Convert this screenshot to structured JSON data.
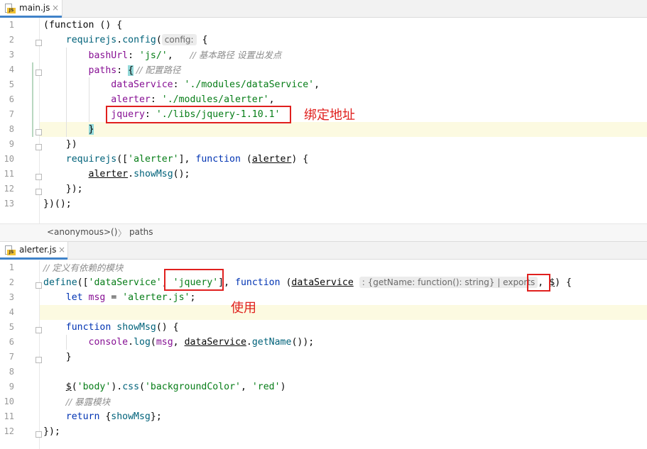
{
  "editor_top": {
    "tab": {
      "name": "main.js",
      "close": "×",
      "icon": "js-file-icon",
      "icon_label": "JS"
    },
    "lines": [
      {
        "n": "1"
      },
      {
        "n": "2"
      },
      {
        "n": "3"
      },
      {
        "n": "4"
      },
      {
        "n": "5"
      },
      {
        "n": "6"
      },
      {
        "n": "7"
      },
      {
        "n": "8"
      },
      {
        "n": "9"
      },
      {
        "n": "10"
      },
      {
        "n": "11"
      },
      {
        "n": "12"
      },
      {
        "n": "13"
      }
    ],
    "tokens": {
      "l1_a": "(function () {",
      "l2_a": "requirejs",
      "l2_b": ".",
      "l2_c": "config",
      "l2_d": "(",
      "l2_hint": "config:",
      "l2_e": " {",
      "l3_a": "bashUrl",
      "l3_b": ": ",
      "l3_c": "'js/'",
      "l3_d": ",   ",
      "l3_cm": "// 基本路径 设置出发点",
      "l4_a": "paths",
      "l4_b": ": ",
      "l4_c": "{",
      "l4_cm": " // 配置路径",
      "l5_a": "dataService",
      "l5_b": ": ",
      "l5_c": "'./modules/dataService'",
      "l5_d": ",",
      "l6_a": "alerter",
      "l6_b": ": ",
      "l6_c": "'./modules/alerter'",
      "l6_d": ",",
      "l7_a": "jquery",
      "l7_b": ": ",
      "l7_c": "'./libs/jquery-1.10.1'",
      "l8_a": "}",
      "l9_a": "})",
      "l10_a": "requirejs",
      "l10_b": "([",
      "l10_c": "'alerter'",
      "l10_d": "], ",
      "l10_e": "function",
      "l10_f": " (",
      "l10_g": "alerter",
      "l10_h": ") {",
      "l11_a": "alerter",
      "l11_b": ".",
      "l11_c": "showMsg",
      "l11_d": "();",
      "l12_a": "});",
      "l13_a": "})();"
    },
    "annotation": "绑定地址"
  },
  "breadcrumb": {
    "item1": "<anonymous>()",
    "sep": "〉",
    "item2": "paths"
  },
  "editor_bottom": {
    "tab": {
      "name": "alerter.js",
      "close": "×",
      "icon": "js-file-icon",
      "icon_label": "JS"
    },
    "lines": [
      {
        "n": "1"
      },
      {
        "n": "2"
      },
      {
        "n": "3"
      },
      {
        "n": "4"
      },
      {
        "n": "5"
      },
      {
        "n": "6"
      },
      {
        "n": "7"
      },
      {
        "n": "8"
      },
      {
        "n": "9"
      },
      {
        "n": "10"
      },
      {
        "n": "11"
      },
      {
        "n": "12"
      }
    ],
    "tokens": {
      "l1_cm": "// 定义有依赖的模块",
      "l2_a": "define",
      "l2_b": "([",
      "l2_c": "'dataService'",
      "l2_d": ", ",
      "l2_e": "'jquery'",
      "l2_f": "], ",
      "l2_g": "function",
      "l2_h": " (",
      "l2_i": "dataService",
      "l2_hint": ": {getName: function(): string} | exports",
      "l2_j": ", ",
      "l2_k": "$",
      "l2_l": ") {",
      "l3_a": "let",
      "l3_b": " ",
      "l3_c": "msg",
      "l3_d": " = ",
      "l3_e": "'alerter.js'",
      "l3_f": ";",
      "l5_a": "function",
      "l5_b": " ",
      "l5_c": "showMsg",
      "l5_d": "() {",
      "l6_a": "console",
      "l6_b": ".",
      "l6_c": "log",
      "l6_d": "(",
      "l6_e": "msg",
      "l6_f": ", ",
      "l6_g": "dataService",
      "l6_h": ".",
      "l6_i": "getName",
      "l6_j": "());",
      "l7_a": "}",
      "l9_a": "$",
      "l9_b": "(",
      "l9_c": "'body'",
      "l9_d": ").",
      "l9_e": "css",
      "l9_f": "(",
      "l9_g": "'backgroundColor'",
      "l9_h": ", ",
      "l9_i": "'red'",
      "l9_j": ")",
      "l10_cm": "// 暴露模块",
      "l11_a": "return",
      "l11_b": " {",
      "l11_c": "showMsg",
      "l11_d": "};",
      "l12_a": "});"
    },
    "annotation": "使用"
  },
  "colors": {
    "keyword": "#0033b3",
    "string": "#067d17",
    "property": "#871094",
    "function": "#00627a",
    "comment": "#8c8c8c",
    "annotation_red": "#e0201e",
    "current_line": "#fcfae1",
    "tab_accent": "#4083c9"
  }
}
